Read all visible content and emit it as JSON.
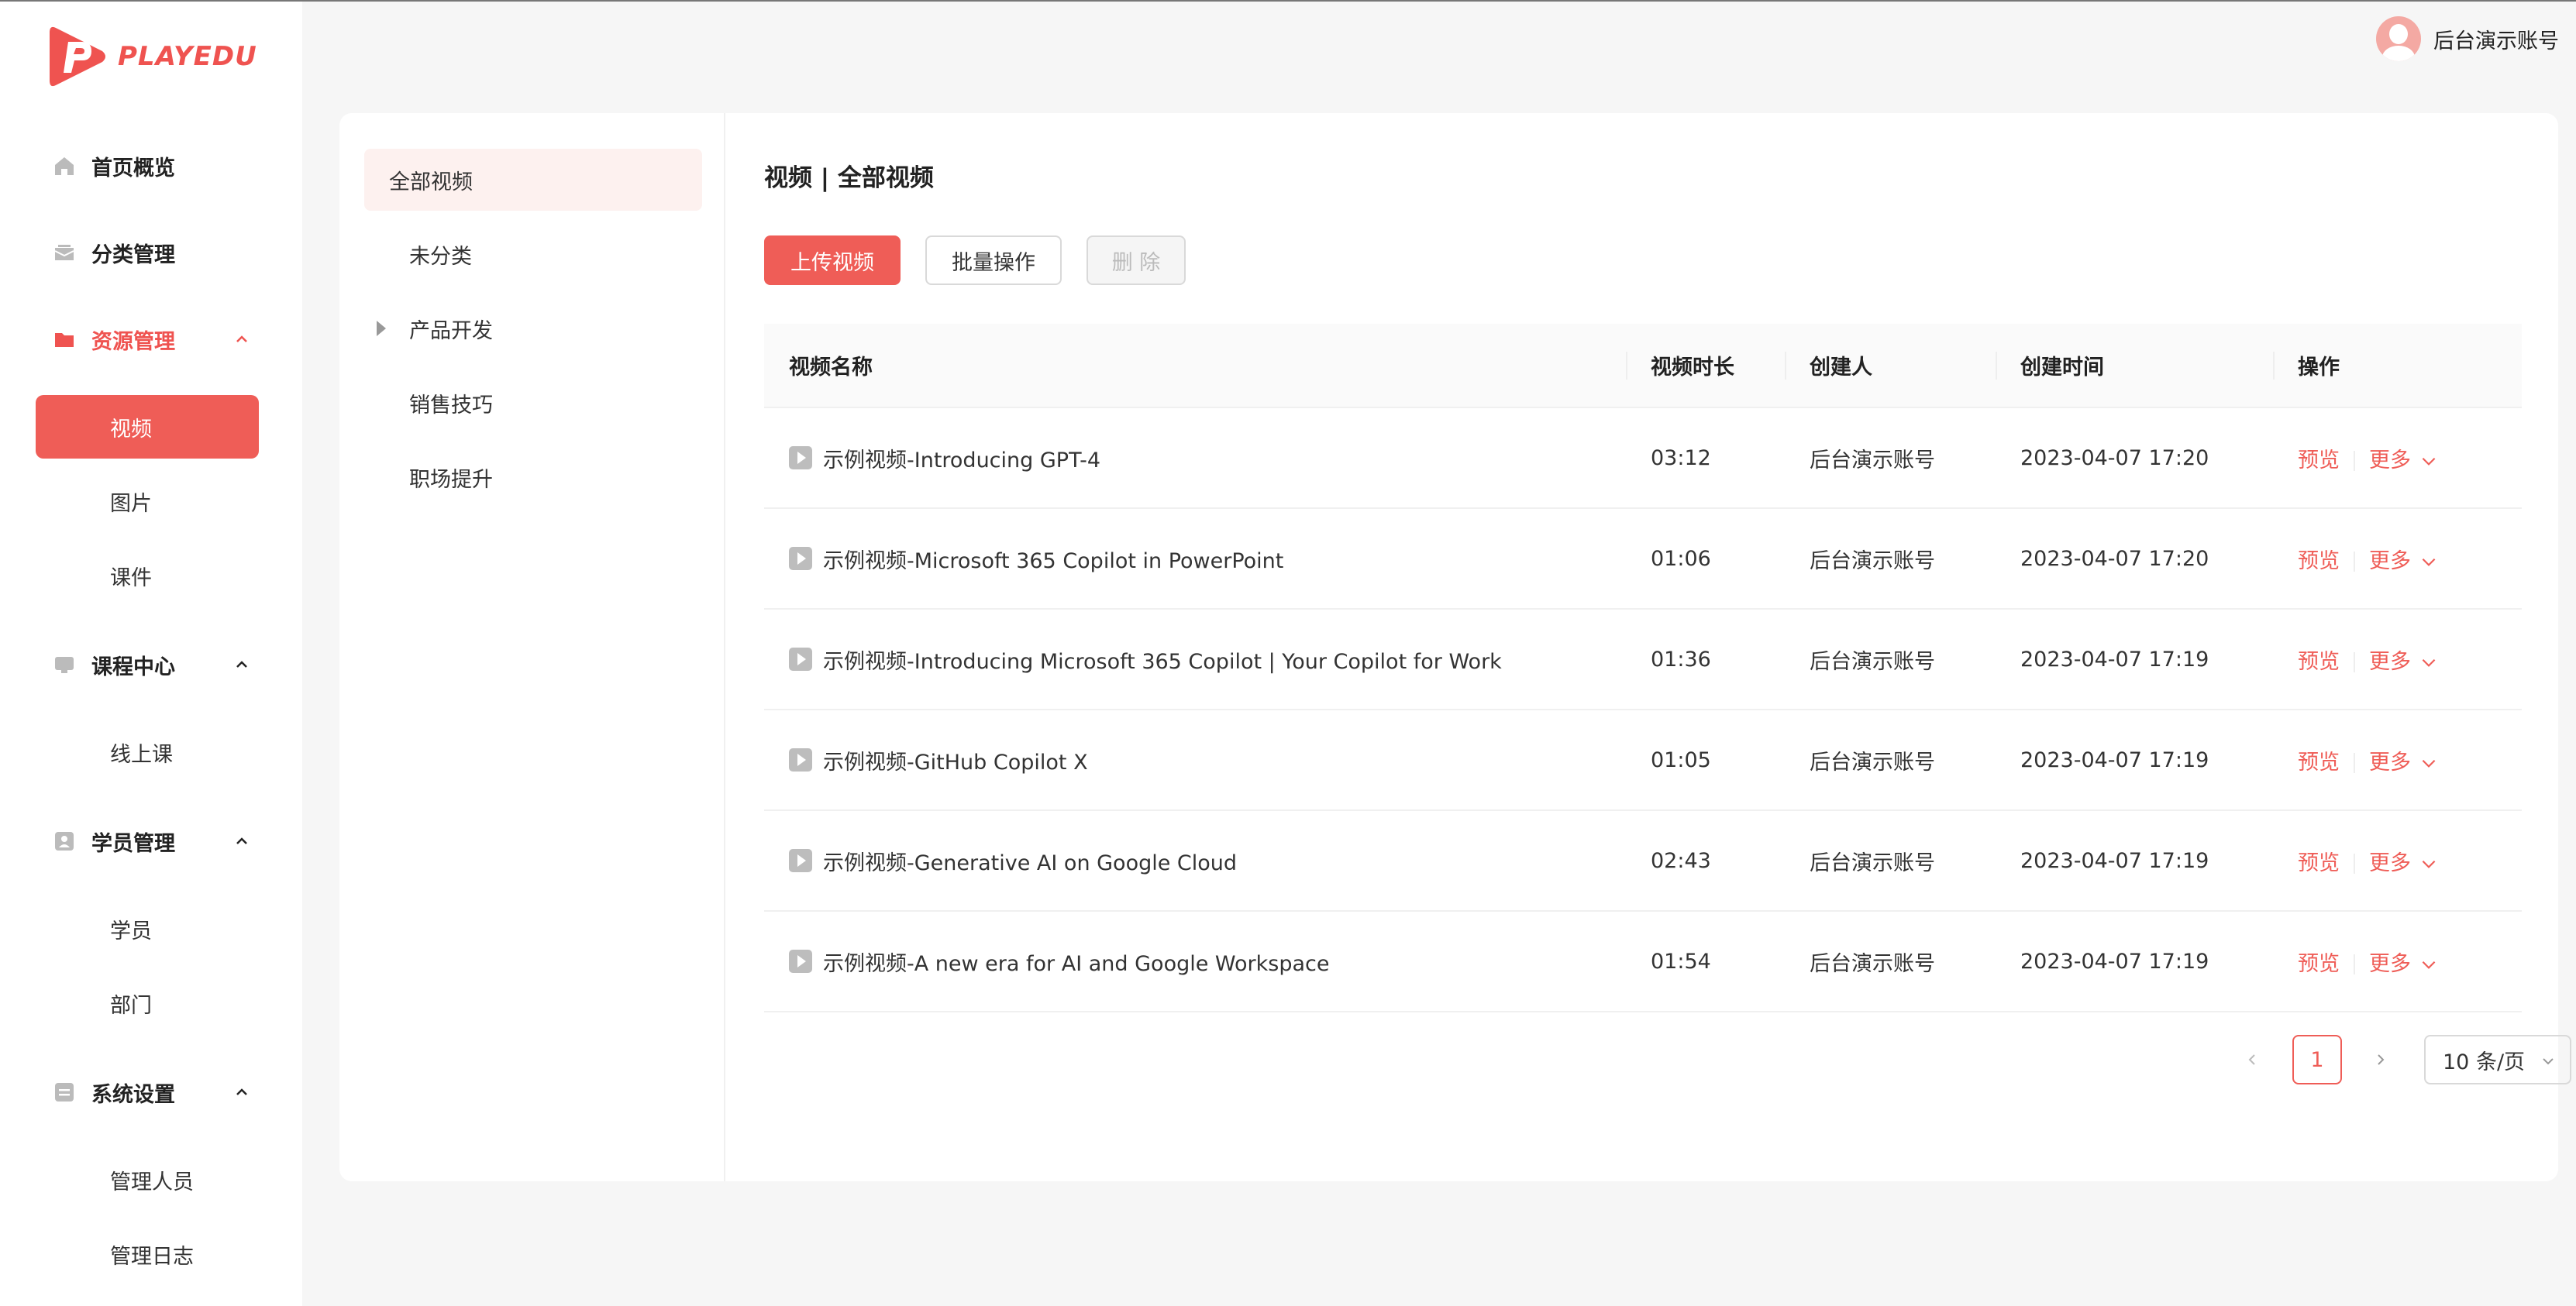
{
  "brand": {
    "name": "PLAYEDU",
    "color": "#ef5350"
  },
  "user": {
    "name": "后台演示账号"
  },
  "sidebar": {
    "groups": [
      {
        "label": "首页概览",
        "icon": "home-icon"
      },
      {
        "label": "分类管理",
        "icon": "category-icon"
      },
      {
        "label": "资源管理",
        "icon": "folder-icon",
        "expanded": true,
        "items": [
          {
            "label": "视频",
            "active": true
          },
          {
            "label": "图片"
          },
          {
            "label": "课件"
          }
        ]
      },
      {
        "label": "课程中心",
        "icon": "course-icon",
        "expanded": true,
        "items": [
          {
            "label": "线上课"
          }
        ]
      },
      {
        "label": "学员管理",
        "icon": "user-card-icon",
        "expanded": true,
        "items": [
          {
            "label": "学员"
          },
          {
            "label": "部门"
          }
        ]
      },
      {
        "label": "系统设置",
        "icon": "settings-icon",
        "expanded": true,
        "items": [
          {
            "label": "管理人员"
          },
          {
            "label": "管理日志"
          }
        ]
      }
    ]
  },
  "categories": [
    {
      "label": "全部视频",
      "active": true
    },
    {
      "label": "未分类"
    },
    {
      "label": "产品开发",
      "has_children": true
    },
    {
      "label": "销售技巧"
    },
    {
      "label": "职场提升"
    }
  ],
  "main": {
    "title": "视频 | 全部视频",
    "buttons": {
      "upload": "上传视频",
      "batch": "批量操作",
      "delete": "删 除"
    },
    "table": {
      "columns": [
        "视频名称",
        "视频时长",
        "创建人",
        "创建时间",
        "操作"
      ],
      "rows": [
        {
          "name": "示例视频-Introducing GPT-4",
          "duration": "03:12",
          "creator": "后台演示账号",
          "created": "2023-04-07 17:20"
        },
        {
          "name": "示例视频-Microsoft 365 Copilot in PowerPoint",
          "duration": "01:06",
          "creator": "后台演示账号",
          "created": "2023-04-07 17:20"
        },
        {
          "name": "示例视频-Introducing Microsoft 365 Copilot | Your Copilot for Work",
          "duration": "01:36",
          "creator": "后台演示账号",
          "created": "2023-04-07 17:19"
        },
        {
          "name": "示例视频-GitHub Copilot X",
          "duration": "01:05",
          "creator": "后台演示账号",
          "created": "2023-04-07 17:19"
        },
        {
          "name": "示例视频-Generative AI on Google Cloud",
          "duration": "02:43",
          "creator": "后台演示账号",
          "created": "2023-04-07 17:19"
        },
        {
          "name": "示例视频-A new era for AI and Google Workspace",
          "duration": "01:54",
          "creator": "后台演示账号",
          "created": "2023-04-07 17:19"
        }
      ],
      "actions": {
        "preview": "预览",
        "more": "更多"
      }
    },
    "pagination": {
      "current": "1",
      "page_size": "10 条/页"
    }
  }
}
